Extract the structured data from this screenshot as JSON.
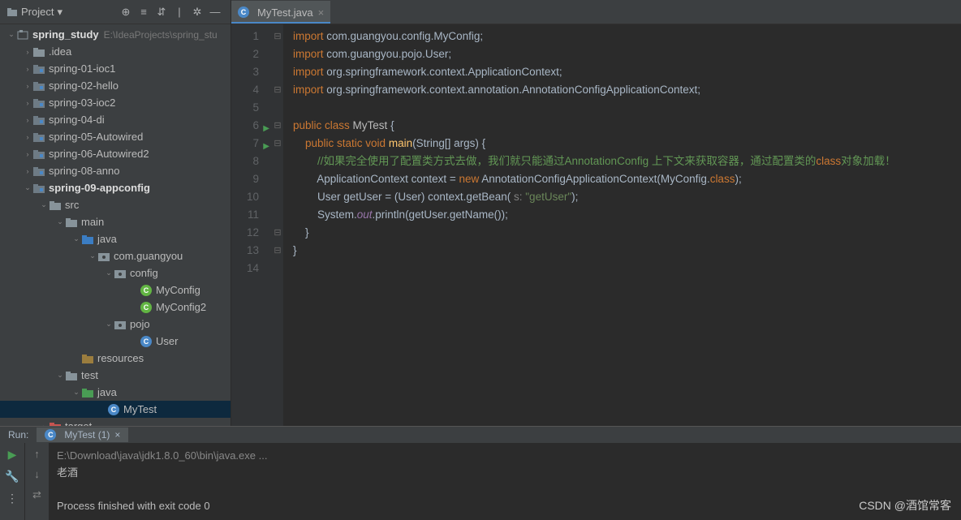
{
  "sidebar": {
    "header": "Project",
    "root": {
      "name": "spring_study",
      "path": "E:\\IdeaProjects\\spring_stu"
    },
    "items": [
      {
        "name": ".idea",
        "indent": 28,
        "arrow": "›",
        "icon": "folder"
      },
      {
        "name": "spring-01-ioc1",
        "indent": 28,
        "arrow": "›",
        "icon": "mod"
      },
      {
        "name": "spring-02-hello",
        "indent": 28,
        "arrow": "›",
        "icon": "mod"
      },
      {
        "name": "spring-03-ioc2",
        "indent": 28,
        "arrow": "›",
        "icon": "mod"
      },
      {
        "name": "spring-04-di",
        "indent": 28,
        "arrow": "›",
        "icon": "mod"
      },
      {
        "name": "spring-05-Autowired",
        "indent": 28,
        "arrow": "›",
        "icon": "mod"
      },
      {
        "name": "spring-06-Autowired2",
        "indent": 28,
        "arrow": "›",
        "icon": "mod"
      },
      {
        "name": "spring-08-anno",
        "indent": 28,
        "arrow": "›",
        "icon": "mod"
      },
      {
        "name": "spring-09-appconfig",
        "indent": 28,
        "arrow": "⌄",
        "icon": "mod",
        "bold": true
      },
      {
        "name": "src",
        "indent": 48,
        "arrow": "⌄",
        "icon": "folder"
      },
      {
        "name": "main",
        "indent": 68,
        "arrow": "⌄",
        "icon": "folder"
      },
      {
        "name": "java",
        "indent": 88,
        "arrow": "⌄",
        "icon": "src"
      },
      {
        "name": "com.guangyou",
        "indent": 108,
        "arrow": "⌄",
        "icon": "pkg"
      },
      {
        "name": "config",
        "indent": 128,
        "arrow": "⌄",
        "icon": "pkg"
      },
      {
        "name": "MyConfig",
        "indent": 160,
        "arrow": "",
        "icon": "cfg"
      },
      {
        "name": "MyConfig2",
        "indent": 160,
        "arrow": "",
        "icon": "cfg"
      },
      {
        "name": "pojo",
        "indent": 128,
        "arrow": "⌄",
        "icon": "pkg"
      },
      {
        "name": "User",
        "indent": 160,
        "arrow": "",
        "icon": "java"
      },
      {
        "name": "resources",
        "indent": 88,
        "arrow": "",
        "icon": "res"
      },
      {
        "name": "test",
        "indent": 68,
        "arrow": "⌄",
        "icon": "folder"
      },
      {
        "name": "java",
        "indent": 88,
        "arrow": "⌄",
        "icon": "test"
      },
      {
        "name": "MyTest",
        "indent": 120,
        "arrow": "",
        "icon": "java",
        "sel": true
      },
      {
        "name": "target",
        "indent": 48,
        "arrow": "›",
        "icon": "target"
      }
    ]
  },
  "editor": {
    "tab": "MyTest.java",
    "lines": [
      {
        "n": 1,
        "fold": "⊟",
        "html": "<span class='k'>import</span> com.guangyou.config.MyConfig;"
      },
      {
        "n": 2,
        "html": "<span class='k'>import</span> com.guangyou.pojo.User;"
      },
      {
        "n": 3,
        "html": "<span class='k'>import</span> org.springframework.context.ApplicationContext;"
      },
      {
        "n": 4,
        "fold": "⊟",
        "html": "<span class='k'>import</span> org.springframework.context.annotation.AnnotationConfigApplicationContext;"
      },
      {
        "n": 5,
        "html": ""
      },
      {
        "n": 6,
        "run": true,
        "fold": "⊟",
        "html": "<span class='k'>public class</span> <span class='an'>MyTest</span> {"
      },
      {
        "n": 7,
        "run": true,
        "fold": "⊟",
        "html": "    <span class='k'>public static void</span> <span class='f'>main</span>(String[] args) {"
      },
      {
        "n": 8,
        "html": "        <span class='cm'>//如果完全使用了配置类方式去做，我们就只能通过AnnotationConfig 上下文来获取容器，通过配置类的</span><span class='hl'>class</span><span class='cm'>对象加载！</span>"
      },
      {
        "n": 9,
        "html": "        ApplicationContext context = <span class='k'>new</span> AnnotationConfigApplicationContext(MyConfig.<span class='k'>class</span>);"
      },
      {
        "n": 10,
        "html": "        User getUser = (User) context.getBean( <span class='c'>s:</span> <span class='s'>\"getUser\"</span>);"
      },
      {
        "n": 11,
        "html": "        System.<span class='it'>out</span>.println(getUser.getName());"
      },
      {
        "n": 12,
        "fold": "⊟",
        "html": "    }"
      },
      {
        "n": 13,
        "fold": "⊟",
        "html": "}"
      },
      {
        "n": 14,
        "html": ""
      }
    ]
  },
  "run": {
    "label": "Run:",
    "tab": "MyTest (1)",
    "out1": "E:\\Download\\java\\jdk1.8.0_60\\bin\\java.exe ...",
    "out2": "老酒",
    "out3": "Process finished with exit code 0"
  },
  "watermark": "CSDN @酒馆常客"
}
